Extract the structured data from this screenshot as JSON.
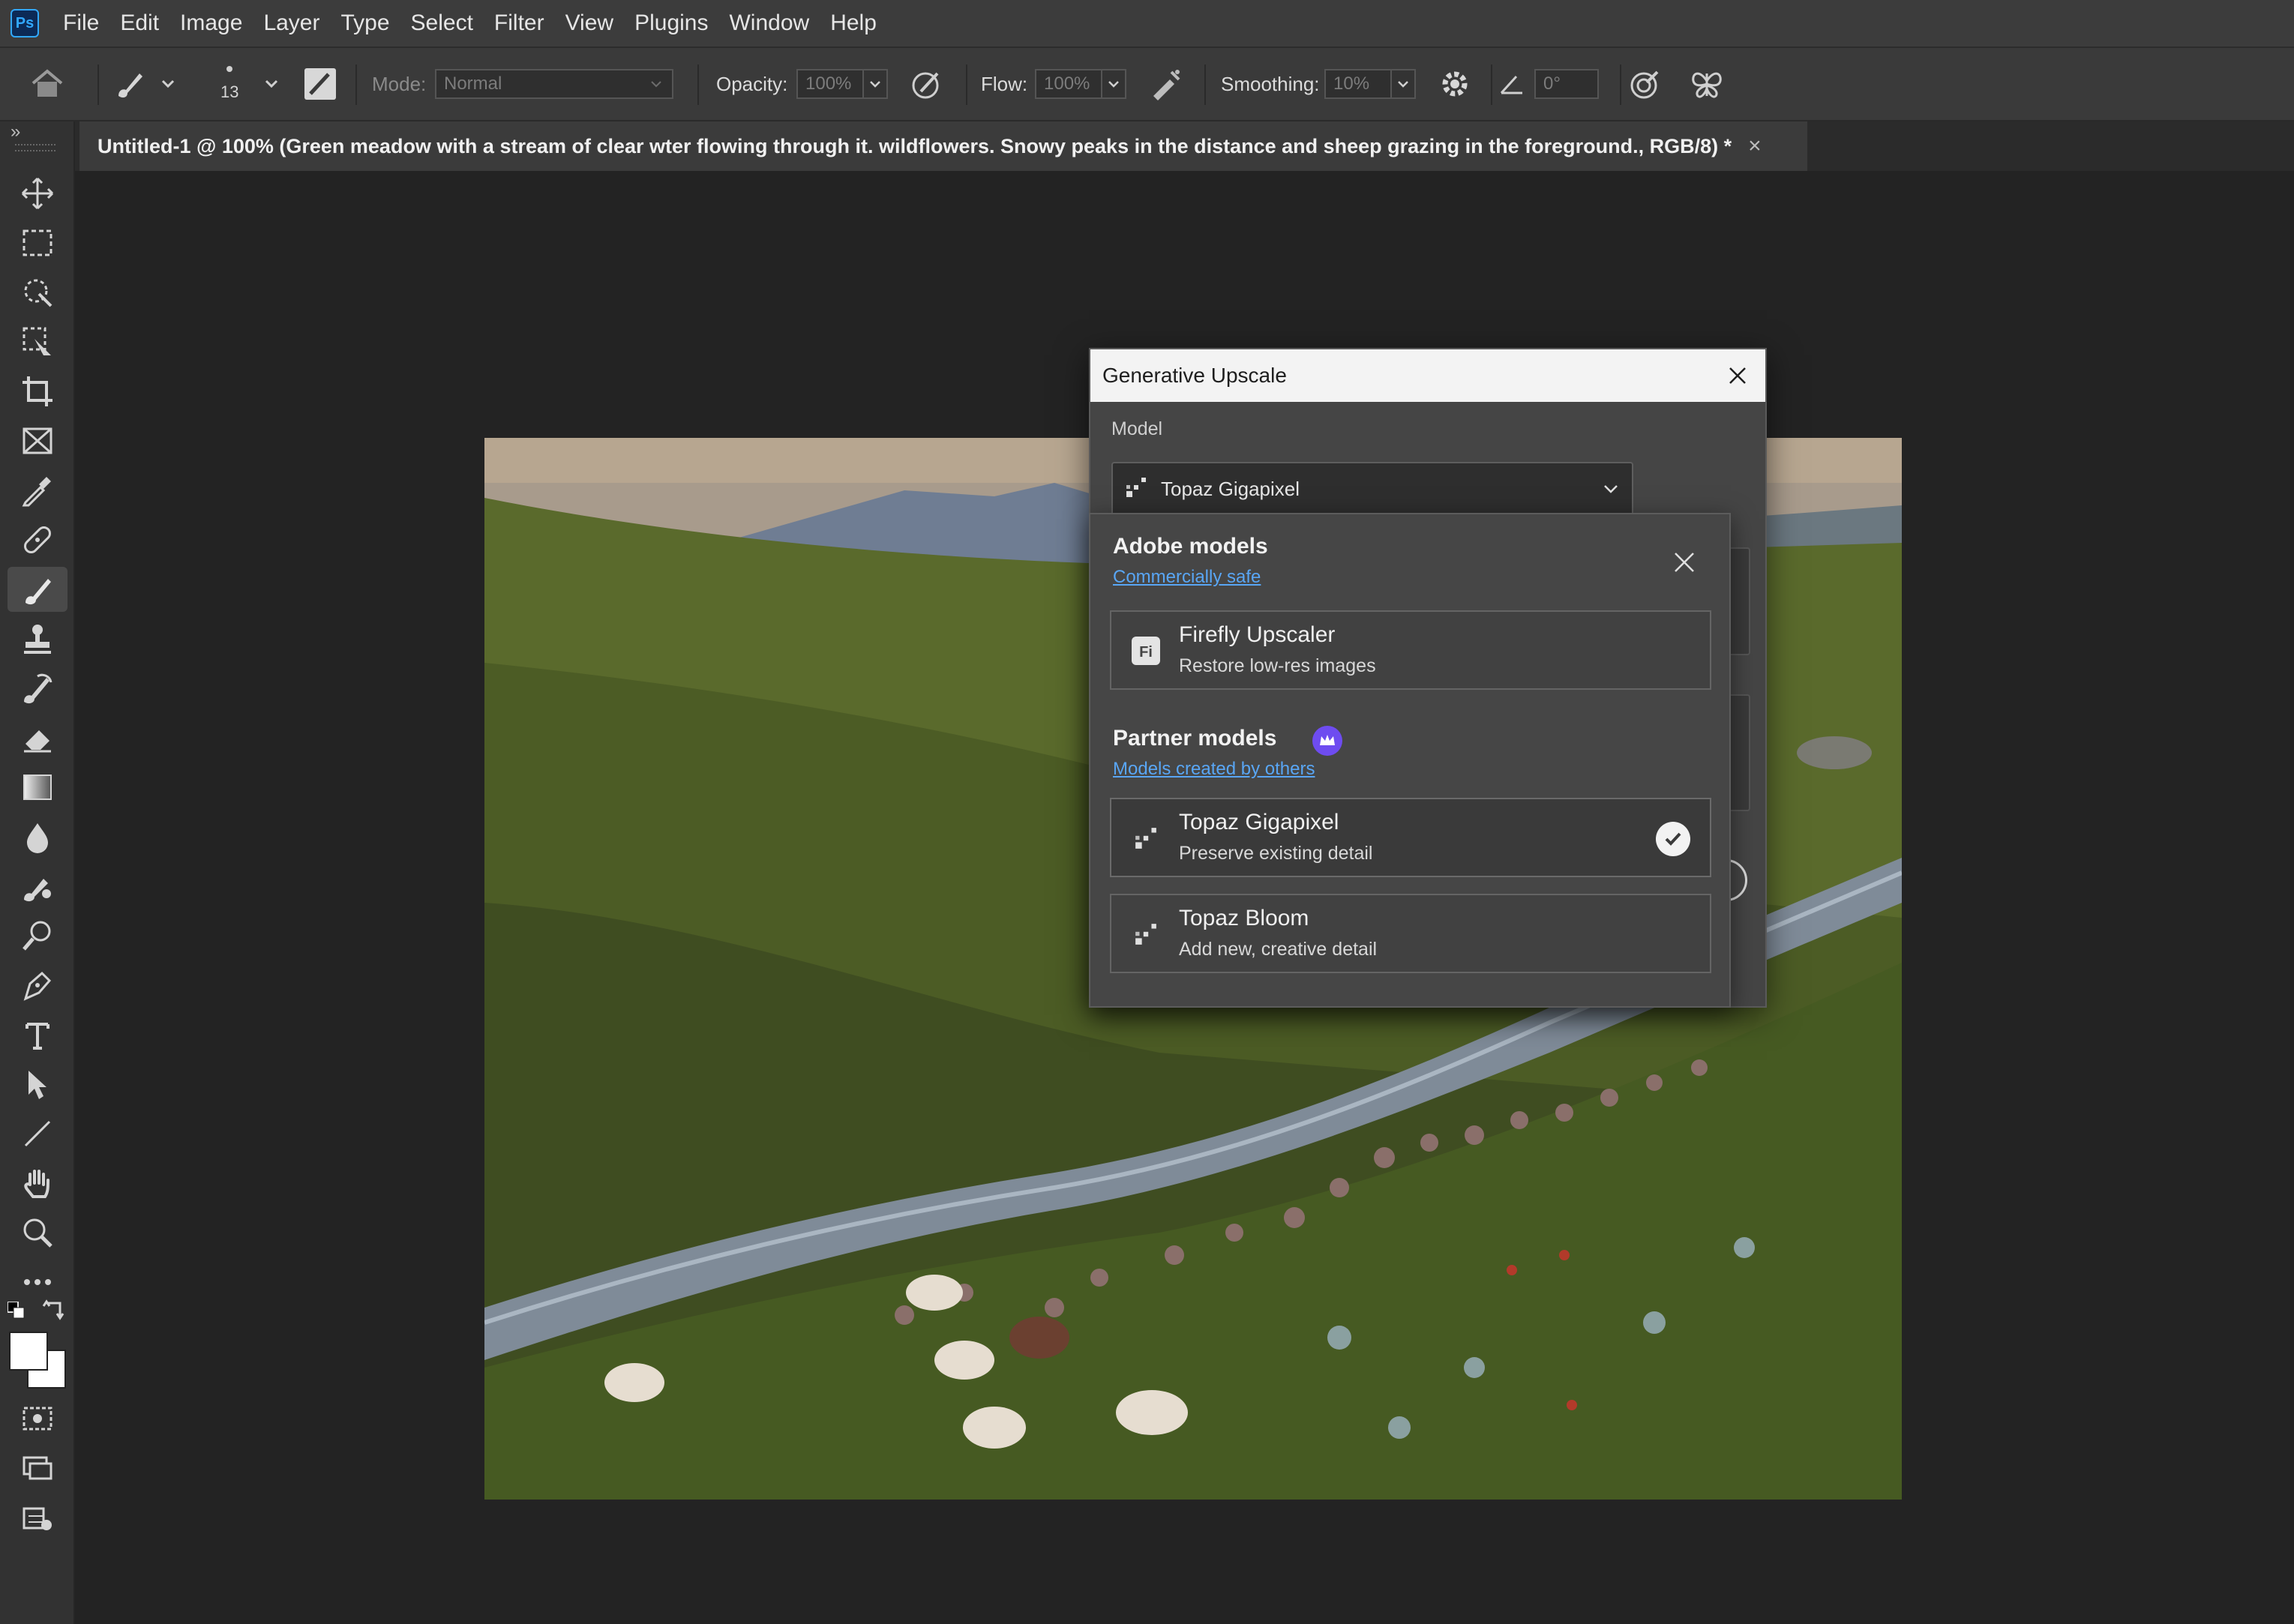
{
  "app": {
    "logo_text": "Ps"
  },
  "menu": [
    "File",
    "Edit",
    "Image",
    "Layer",
    "Type",
    "Select",
    "Filter",
    "View",
    "Plugins",
    "Window",
    "Help"
  ],
  "options_bar": {
    "brush_size": "13",
    "mode_label": "Mode:",
    "mode_value": "Normal",
    "opacity_label": "Opacity:",
    "opacity_value": "100%",
    "flow_label": "Flow:",
    "flow_value": "100%",
    "smoothing_label": "Smoothing:",
    "smoothing_value": "10%",
    "angle_value": "0°"
  },
  "document_tab": {
    "title": "Untitled-1 @ 100% (Green meadow with a stream of clear wter flowing through it. wildflowers. Snowy peaks in the distance and sheep grazing in the foreground., RGB/8) *",
    "close_glyph": "×"
  },
  "dialog": {
    "title": "Generative Upscale",
    "model_label": "Model",
    "selected_model": "Topaz Gigapixel"
  },
  "model_dropdown": {
    "adobe_group": {
      "title": "Adobe models",
      "subtitle": "Commercially safe"
    },
    "adobe_options": [
      {
        "name": "Firefly Upscaler",
        "desc": "Restore low-res images",
        "icon": "firefly-icon"
      }
    ],
    "partner_group": {
      "title": "Partner models",
      "subtitle": "Models created by others",
      "badge_icon": "crown-icon"
    },
    "partner_options": [
      {
        "name": "Topaz Gigapixel",
        "desc": "Preserve existing detail",
        "icon": "topaz-icon",
        "selected": true
      },
      {
        "name": "Topaz Bloom",
        "desc": "Add new, creative detail",
        "icon": "topaz-icon",
        "selected": false
      }
    ]
  },
  "colors": {
    "accent_link": "#59a6f5",
    "badge_purple": "#6e4cf0",
    "ps_blue": "#31a8ff"
  }
}
